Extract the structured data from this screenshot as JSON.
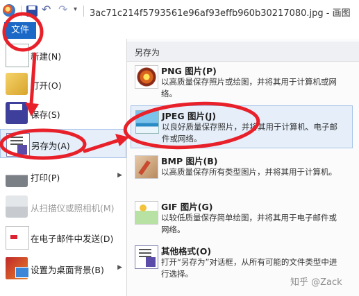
{
  "window": {
    "title": "3ac71c214f5793561e96af93effb960b30217080.jpg - 画图"
  },
  "quick_access": {
    "undo_glyph": "↶",
    "redo_glyph": "↷",
    "dropdown_glyph": "▾"
  },
  "file_tab": {
    "label": "文件"
  },
  "menu": {
    "items": [
      {
        "label": "新建(N)",
        "icon": "new-icon"
      },
      {
        "label": "打开(O)",
        "icon": "open-folder-icon"
      },
      {
        "label": "保存(S)",
        "icon": "save-disk-icon"
      },
      {
        "label": "另存为(A)",
        "icon": "save-as-icon",
        "state": "active"
      },
      {
        "label": "打印(P)",
        "icon": "printer-icon",
        "submenu": true
      },
      {
        "label": "从扫描仪或照相机(M)",
        "icon": "scanner-icon",
        "state": "disabled"
      },
      {
        "label": "在电子邮件中发送(D)",
        "icon": "email-icon"
      },
      {
        "label": "设置为桌面背景(B)",
        "icon": "desktop-background-icon",
        "submenu": true
      }
    ],
    "submenu_arrow": "▶"
  },
  "pane": {
    "title": "另存为",
    "options": [
      {
        "title": "PNG 图片(P)",
        "desc": "以高质量保存照片或绘图，并将其用于计算机或网络。",
        "icon": "png-image-icon"
      },
      {
        "title": "JPEG 图片(J)",
        "desc": "以良好质量保存照片，并将其用于计算机、电子邮件或网络。",
        "icon": "jpeg-image-icon",
        "state": "hover"
      },
      {
        "title": "BMP 图片(B)",
        "desc": "以高质量保存所有类型图片，并将其用于计算机。",
        "icon": "bmp-image-icon"
      },
      {
        "title": "GIF 图片(G)",
        "desc": "以较低质量保存简单绘图，并将其用于电子邮件或网络。",
        "icon": "gif-image-icon"
      },
      {
        "title": "其他格式(O)",
        "desc": "打开“另存为”对话框，从所有可能的文件类型中进行选择。",
        "icon": "other-formats-icon"
      }
    ]
  },
  "watermark": "知乎 @Zack",
  "colors": {
    "accent": "#1b68c6",
    "annotation": "#e8202a",
    "highlight": "#e5eef9"
  }
}
